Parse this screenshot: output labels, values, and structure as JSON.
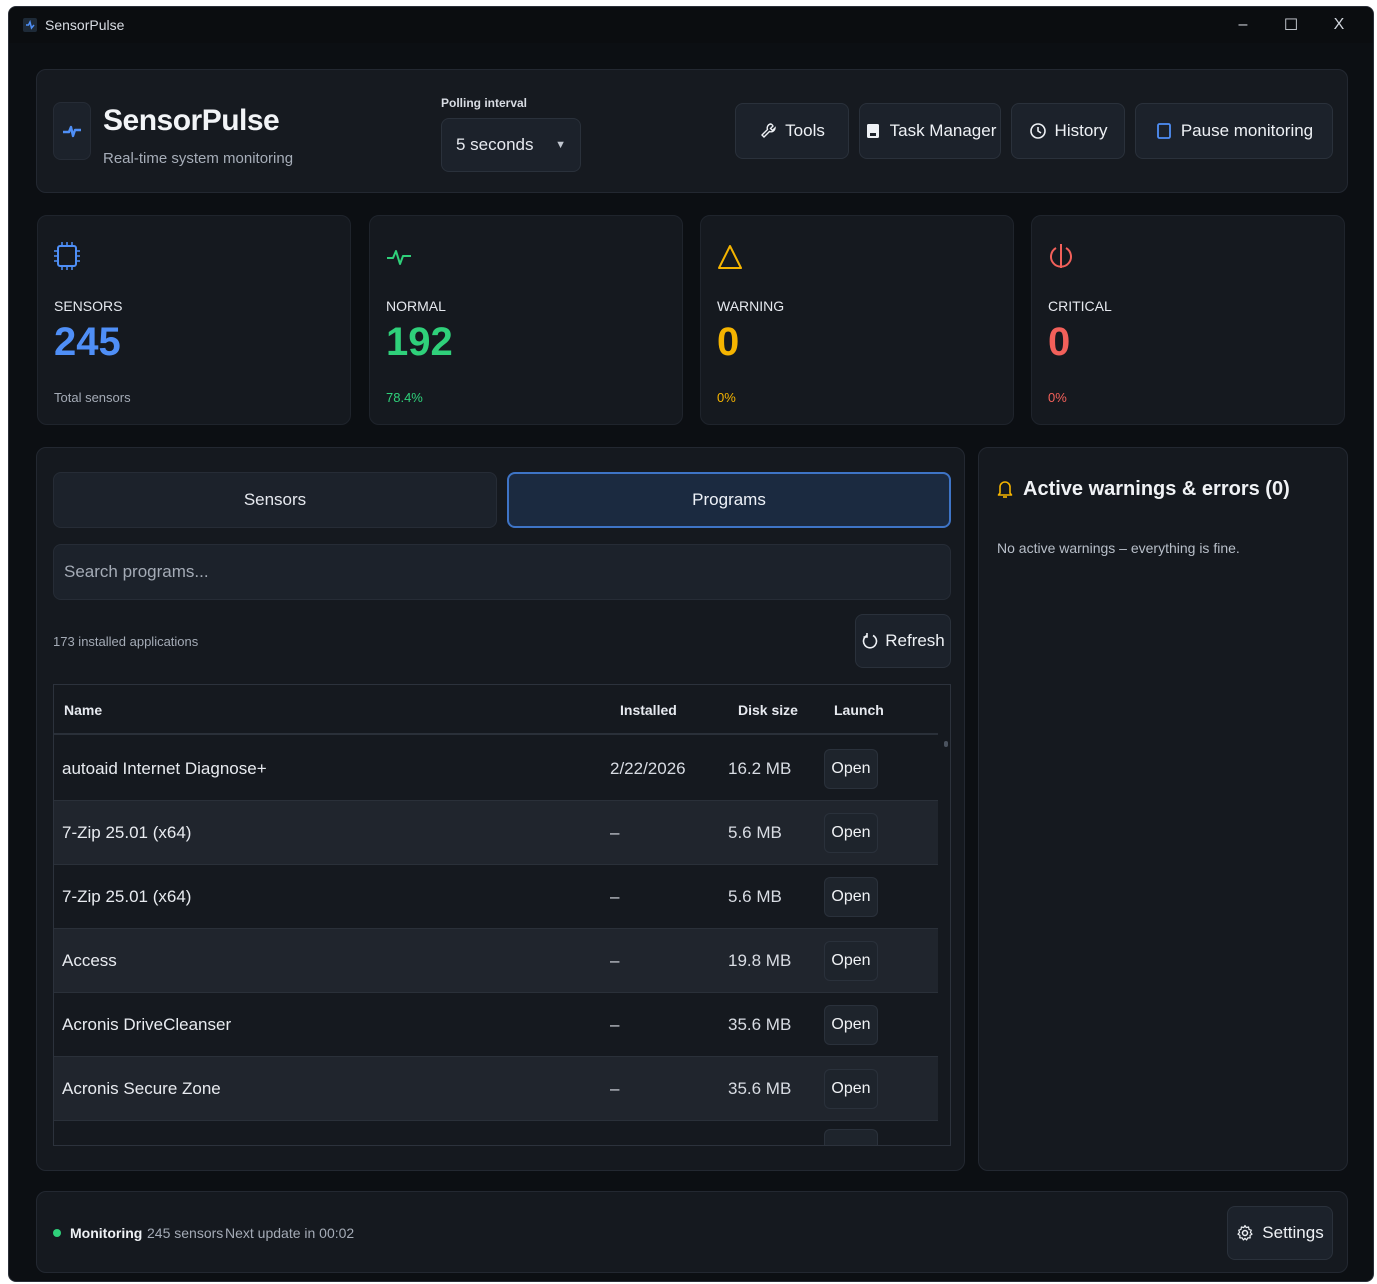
{
  "window": {
    "title": "SensorPulse",
    "controls": [
      "–",
      "☐",
      "X"
    ]
  },
  "header": {
    "app_name": "SensorPulse",
    "subtitle": "Real-time system monitoring",
    "polling_label": "Polling interval",
    "polling_value": "5 seconds",
    "buttons": {
      "tools": "Tools",
      "task_manager": "Task Manager",
      "history": "History",
      "pause": "Pause monitoring"
    }
  },
  "stats": [
    {
      "label": "SENSORS",
      "value": "245",
      "sub": "Total sensors",
      "color": "#4f8ff7",
      "sub_color": "#a4abb6"
    },
    {
      "label": "NORMAL",
      "value": "192",
      "sub": "78.4%",
      "color": "#2fd07a",
      "sub_color": "#2fd07a"
    },
    {
      "label": "WARNING",
      "value": "0",
      "sub": "0%",
      "color": "#f5b400",
      "sub_color": "#f5b400"
    },
    {
      "label": "CRITICAL",
      "value": "0",
      "sub": "0%",
      "color": "#f2605a",
      "sub_color": "#f2605a"
    }
  ],
  "tabs": {
    "sensors": "Sensors",
    "programs": "Programs",
    "active": "Programs"
  },
  "search": {
    "placeholder": "Search programs...",
    "value": ""
  },
  "programs": {
    "count_text": "173 installed applications",
    "refresh_label": "Refresh",
    "columns": [
      "Name",
      "Installed",
      "Disk size",
      "Launch"
    ],
    "rows": [
      {
        "name": "autoaid Internet Diagnose+",
        "installed": "2/22/2026",
        "size": "16.2 MB",
        "launch": "Open"
      },
      {
        "name": "7-Zip 25.01 (x64)",
        "installed": "–",
        "size": "5.6 MB",
        "launch": "Open"
      },
      {
        "name": "7-Zip 25.01 (x64)",
        "installed": "–",
        "size": "5.6 MB",
        "launch": "Open"
      },
      {
        "name": "Access",
        "installed": "–",
        "size": "19.8 MB",
        "launch": "Open"
      },
      {
        "name": "Acronis DriveCleanser",
        "installed": "–",
        "size": "35.6 MB",
        "launch": "Open"
      },
      {
        "name": "Acronis Secure Zone",
        "installed": "–",
        "size": "35.6 MB",
        "launch": "Open"
      }
    ]
  },
  "warnings": {
    "title": "Active warnings & errors (0)",
    "message": "No active warnings – everything is fine."
  },
  "footer": {
    "status": "Monitoring",
    "sensor_count": "245 sensors",
    "next_update": "Next update in 00:02",
    "settings_label": "Settings"
  },
  "colors": {
    "accent": "#3e74c6",
    "ok": "#2fd07a",
    "warn": "#f5b400",
    "crit": "#f2605a",
    "info": "#4f8ff7"
  }
}
